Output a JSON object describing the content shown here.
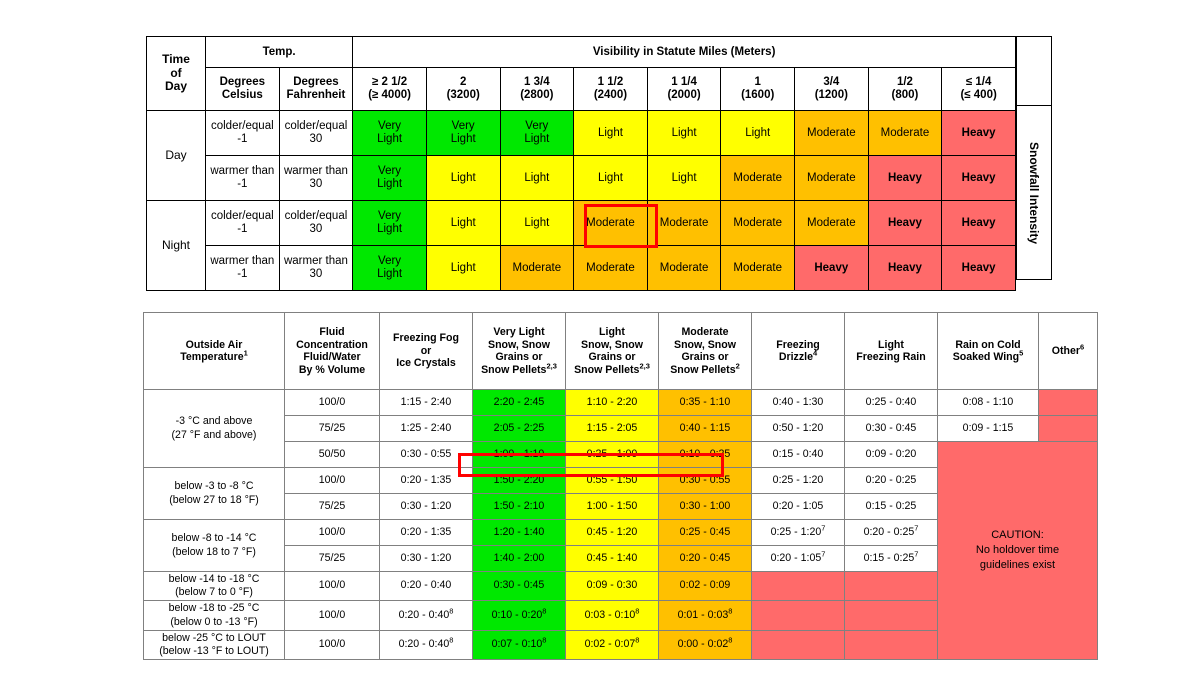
{
  "snowfall_table": {
    "header": {
      "time_of_day": "Time\nof\nDay",
      "temp_group": "Temp.",
      "visibility_group": "Visibility in Statute Miles (Meters)",
      "degrees_celsius": "Degrees\nCelsius",
      "degrees_fahrenheit": "Degrees\nFahrenheit",
      "side_label": "Snowfall Intensity",
      "visibility_columns": [
        {
          "miles": "≥ 2 1/2",
          "meters": "(≥ 4000)"
        },
        {
          "miles": "2",
          "meters": "(3200)"
        },
        {
          "miles": "1 3/4",
          "meters": "(2800)"
        },
        {
          "miles": "1 1/2",
          "meters": "(2400)"
        },
        {
          "miles": "1 1/4",
          "meters": "(2000)"
        },
        {
          "miles": "1",
          "meters": "(1600)"
        },
        {
          "miles": "3/4",
          "meters": "(1200)"
        },
        {
          "miles": "1/2",
          "meters": "(800)"
        },
        {
          "miles": "≤ 1/4",
          "meters": "(≤ 400)"
        }
      ]
    },
    "rows": [
      {
        "time_of_day": "Day",
        "celsius": "colder/equal\n-1",
        "fahrenheit": "colder/equal\n30",
        "cells": [
          {
            "text": "Very\nLight",
            "color": "green"
          },
          {
            "text": "Very\nLight",
            "color": "green"
          },
          {
            "text": "Very\nLight",
            "color": "green"
          },
          {
            "text": "Light",
            "color": "yellow"
          },
          {
            "text": "Light",
            "color": "yellow"
          },
          {
            "text": "Light",
            "color": "yellow"
          },
          {
            "text": "Moderate",
            "color": "orange"
          },
          {
            "text": "Moderate",
            "color": "orange"
          },
          {
            "text": "Heavy",
            "color": "red"
          }
        ]
      },
      {
        "time_of_day": "",
        "celsius": "warmer than\n-1",
        "fahrenheit": "warmer than\n30",
        "cells": [
          {
            "text": "Very\nLight",
            "color": "green"
          },
          {
            "text": "Light",
            "color": "yellow"
          },
          {
            "text": "Light",
            "color": "yellow"
          },
          {
            "text": "Light",
            "color": "yellow"
          },
          {
            "text": "Light",
            "color": "yellow"
          },
          {
            "text": "Moderate",
            "color": "orange"
          },
          {
            "text": "Moderate",
            "color": "orange"
          },
          {
            "text": "Heavy",
            "color": "red"
          },
          {
            "text": "Heavy",
            "color": "red"
          }
        ]
      },
      {
        "time_of_day": "Night",
        "celsius": "colder/equal\n-1",
        "fahrenheit": "colder/equal\n30",
        "cells": [
          {
            "text": "Very\nLight",
            "color": "green"
          },
          {
            "text": "Light",
            "color": "yellow"
          },
          {
            "text": "Light",
            "color": "yellow"
          },
          {
            "text": "Moderate",
            "color": "orange"
          },
          {
            "text": "Moderate",
            "color": "orange"
          },
          {
            "text": "Moderate",
            "color": "orange"
          },
          {
            "text": "Moderate",
            "color": "orange"
          },
          {
            "text": "Heavy",
            "color": "red"
          },
          {
            "text": "Heavy",
            "color": "red"
          }
        ]
      },
      {
        "time_of_day": "",
        "celsius": "warmer than\n-1",
        "fahrenheit": "warmer than\n30",
        "cells": [
          {
            "text": "Very\nLight",
            "color": "green"
          },
          {
            "text": "Light",
            "color": "yellow"
          },
          {
            "text": "Moderate",
            "color": "orange"
          },
          {
            "text": "Moderate",
            "color": "orange"
          },
          {
            "text": "Moderate",
            "color": "orange"
          },
          {
            "text": "Moderate",
            "color": "orange"
          },
          {
            "text": "Heavy",
            "color": "red"
          },
          {
            "text": "Heavy",
            "color": "red"
          },
          {
            "text": "Heavy",
            "color": "red"
          }
        ]
      }
    ],
    "highlight_cell": "Night / colder-equal -1 / 1 1/2 (2400) = Moderate"
  },
  "holdover_table": {
    "headers": {
      "outside_air_temperature": "Outside Air\nTemperature",
      "outside_air_temperature_sup": "1",
      "fluid_concentration": "Fluid\nConcentration\nFluid/Water\nBy % Volume",
      "freezing_fog": "Freezing Fog\nor\nIce Crystals",
      "very_light_snow": "Very Light\nSnow, Snow\nGrains or\nSnow Pellets",
      "very_light_snow_sup": "2,3",
      "light_snow": "Light\nSnow, Snow\nGrains or\nSnow Pellets",
      "light_snow_sup": "2,3",
      "moderate_snow": "Moderate\nSnow, Snow\nGrains or\nSnow Pellets",
      "moderate_snow_sup": "2",
      "freezing_drizzle": "Freezing\nDrizzle",
      "freezing_drizzle_sup": "4",
      "light_freezing_rain": "Light\nFreezing Rain",
      "rain_on_cold_soaked_wing": "Rain on Cold\nSoaked Wing",
      "rain_on_cold_soaked_wing_sup": "5",
      "other": "Other",
      "other_sup": "6"
    },
    "caution": "CAUTION:\nNo holdover time\nguidelines exist",
    "groups": [
      {
        "oat": "-3 °C and above\n(27 °F and above)",
        "rows": [
          {
            "conc": "100/0",
            "ffog": "1:15 - 2:40",
            "vls": "2:20 - 2:45",
            "ls": "1:10 - 2:20",
            "ms": "0:35 - 1:10",
            "fd": "0:40 - 1:30",
            "lfr": "0:25 - 0:40",
            "rocw": "0:08 - 1:10"
          },
          {
            "conc": "75/25",
            "ffog": "1:25 - 2:40",
            "vls": "2:05 - 2:25",
            "ls": "1:15 - 2:05",
            "ms": "0:40 - 1:15",
            "fd": "0:50 - 1:20",
            "lfr": "0:30 - 0:45",
            "rocw": "0:09 - 1:15"
          },
          {
            "conc": "50/50",
            "ffog": "0:30 - 0:55",
            "vls": "1:00 - 1:10",
            "ls": "0:25 - 1:00",
            "ms": "0:10 - 0:25",
            "fd": "0:15 - 0:40",
            "lfr": "0:09 - 0:20",
            "rocw": ""
          }
        ]
      },
      {
        "oat": "below -3 to -8 °C\n(below 27 to 18 °F)",
        "rows": [
          {
            "conc": "100/0",
            "ffog": "0:20 - 1:35",
            "vls": "1:50 - 2:20",
            "ls": "0:55 - 1:50",
            "ms": "0:30 - 0:55",
            "fd": "0:25 - 1:20",
            "lfr": "0:20 - 0:25",
            "rocw": ""
          },
          {
            "conc": "75/25",
            "ffog": "0:30 - 1:20",
            "vls": "1:50 - 2:10",
            "ls": "1:00 - 1:50",
            "ms": "0:30 - 1:00",
            "fd": "0:20 - 1:05",
            "lfr": "0:15 - 0:25",
            "rocw": ""
          }
        ]
      },
      {
        "oat": "below -8 to -14 °C\n(below 18 to 7 °F)",
        "rows": [
          {
            "conc": "100/0",
            "ffog": "0:20 - 1:35",
            "vls": "1:20 - 1:40",
            "ls": "0:45 - 1:20",
            "ms": "0:25 - 0:45",
            "fd": "0:25 - 1:20",
            "fd_sup": "7",
            "lfr": "0:20 - 0:25",
            "lfr_sup": "7",
            "rocw": ""
          },
          {
            "conc": "75/25",
            "ffog": "0:30 - 1:20",
            "vls": "1:40 - 2:00",
            "ls": "0:45 - 1:40",
            "ms": "0:20 - 0:45",
            "fd": "0:20 - 1:05",
            "fd_sup": "7",
            "lfr": "0:15 - 0:25",
            "lfr_sup": "7",
            "rocw": ""
          }
        ]
      },
      {
        "oat": "below -14 to -18 °C\n(below 7 to 0 °F)",
        "rows": [
          {
            "conc": "100/0",
            "ffog": "0:20 - 0:40",
            "vls": "0:30 - 0:45",
            "ls": "0:09 - 0:30",
            "ms": "0:02 - 0:09",
            "fd": "",
            "lfr": "",
            "rocw": ""
          }
        ]
      },
      {
        "oat": "below -18 to -25 °C\n(below 0 to -13 °F)",
        "rows": [
          {
            "conc": "100/0",
            "ffog": "0:20 - 0:40",
            "ffog_sup": "8",
            "vls": "0:10 - 0:20",
            "vls_sup": "8",
            "ls": "0:03 - 0:10",
            "ls_sup": "8",
            "ms": "0:01 - 0:03",
            "ms_sup": "8",
            "fd": "",
            "lfr": "",
            "rocw": ""
          }
        ]
      },
      {
        "oat": "below -25 °C to LOUT\n(below -13 °F to LOUT)",
        "rows": [
          {
            "conc": "100/0",
            "ffog": "0:20 - 0:40",
            "ffog_sup": "8",
            "vls": "0:07 - 0:10",
            "vls_sup": "8",
            "ls": "0:02 - 0:07",
            "ls_sup": "8",
            "ms": "0:00 - 0:02",
            "ms_sup": "8",
            "fd": "",
            "lfr": "",
            "rocw": ""
          }
        ]
      }
    ],
    "highlight_cells": "below -3 to -8 °C / 100/0 : 1:50 - 2:20, 0:55 - 1:50, 0:30 - 0:55"
  },
  "colors": {
    "green": "#00E800",
    "yellow": "#FFFF00",
    "orange": "#FFC000",
    "red": "#FF6A6A",
    "highlight": "#FF0000",
    "border_top_table": "#000000",
    "border_bottom_table": "#808080"
  }
}
